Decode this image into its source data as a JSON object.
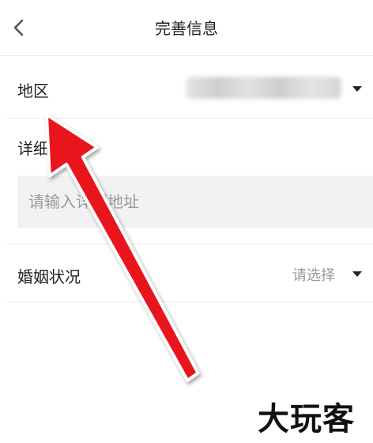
{
  "header": {
    "title": "完善信息",
    "back_icon": "chevron-left-icon"
  },
  "form": {
    "region": {
      "label": "地区",
      "value_state": "blurred"
    },
    "address": {
      "label": "详细地址",
      "placeholder": "请输入详细地址"
    },
    "marital_status": {
      "label": "婚姻状况",
      "placeholder": "请选择"
    }
  },
  "overlay": {
    "annotation": "red-arrow-icon",
    "arrow_color": "#e8141b"
  },
  "watermark": {
    "text": "大玩客"
  }
}
